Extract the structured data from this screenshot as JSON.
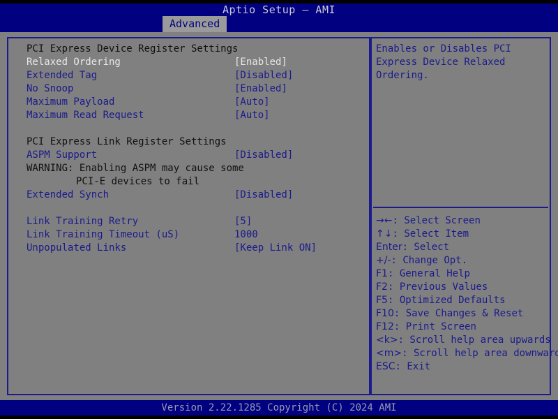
{
  "header": {
    "title": "Aptio Setup – AMI",
    "tabs": [
      {
        "label": "Advanced",
        "active": true
      }
    ]
  },
  "main": {
    "rows": [
      {
        "type": "section",
        "label": "PCI Express Device Register Settings",
        "value": ""
      },
      {
        "type": "item",
        "label": "Relaxed Ordering",
        "value": "[Enabled]",
        "selected": true
      },
      {
        "type": "item",
        "label": "Extended Tag",
        "value": "[Disabled]",
        "selected": false
      },
      {
        "type": "item",
        "label": "No Snoop",
        "value": "[Enabled]",
        "selected": false
      },
      {
        "type": "item",
        "label": "Maximum Payload",
        "value": "[Auto]",
        "selected": false
      },
      {
        "type": "item",
        "label": "Maximum Read Request",
        "value": "[Auto]",
        "selected": false
      },
      {
        "type": "spacer",
        "label": "",
        "value": ""
      },
      {
        "type": "section",
        "label": "PCI Express Link Register Settings",
        "value": ""
      },
      {
        "type": "item",
        "label": "ASPM Support",
        "value": "[Disabled]",
        "selected": false
      },
      {
        "type": "note",
        "label": "WARNING: Enabling ASPM may cause some",
        "value": ""
      },
      {
        "type": "note-indent",
        "label": "PCI-E devices to fail",
        "value": ""
      },
      {
        "type": "item",
        "label": "Extended Synch",
        "value": "[Disabled]",
        "selected": false
      },
      {
        "type": "spacer",
        "label": "",
        "value": ""
      },
      {
        "type": "item",
        "label": "Link Training Retry",
        "value": "[5]",
        "selected": false
      },
      {
        "type": "item",
        "label": "Link Training Timeout (uS)",
        "value": "1000",
        "selected": false
      },
      {
        "type": "item",
        "label": "Unpopulated Links",
        "value": "[Keep Link ON]",
        "selected": false
      }
    ]
  },
  "help": {
    "lines": [
      "Enables or Disables PCI",
      "Express Device Relaxed",
      "Ordering."
    ]
  },
  "legend": {
    "rows": [
      {
        "keys": "→←",
        "text": ": Select Screen"
      },
      {
        "keys": "↑↓",
        "text": ": Select Item"
      },
      {
        "keys": "Enter",
        "text": ": Select"
      },
      {
        "keys": "+/-",
        "text": ": Change Opt."
      },
      {
        "keys": "F1",
        "text": ": General Help"
      },
      {
        "keys": "F2",
        "text": ": Previous Values"
      },
      {
        "keys": "F5",
        "text": ": Optimized Defaults"
      },
      {
        "keys": "F10",
        "text": ": Save Changes & Reset"
      },
      {
        "keys": "F12",
        "text": ": Print Screen"
      },
      {
        "keys": "<k>",
        "text": ": Scroll help area upwards"
      },
      {
        "keys": "<m>",
        "text": ": Scroll help area downwards"
      },
      {
        "keys": "ESC",
        "text": ": Exit"
      }
    ]
  },
  "footer": {
    "version": "Version 2.22.1285 Copyright (C) 2024 AMI"
  },
  "colors": {
    "header_bar": "#000080",
    "body_bg": "#808080",
    "panel_border": "#1a1a8c",
    "item_text": "#1a1a8c",
    "selected_text": "#e8e8e8",
    "section_text": "#101010",
    "footer_text": "#9a9ab4",
    "tab_bg": "#9a9a9a"
  }
}
